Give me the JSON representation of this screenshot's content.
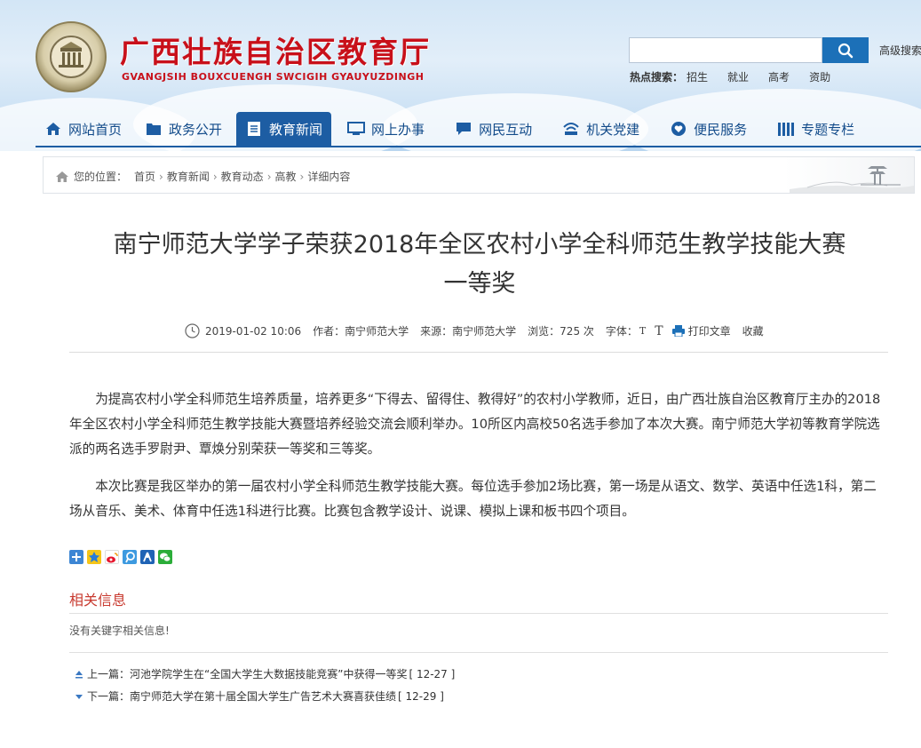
{
  "header": {
    "title": "广西壮族自治区教育厅",
    "subtitle": "GVANGJSIH BOUXCUENGH SWCIGIH GYAUYUZDINGH",
    "search": {
      "placeholder": "",
      "advanced_label": "高级搜索"
    },
    "hot": {
      "label": "热点搜索：",
      "keywords": [
        "招生",
        "就业",
        "高考",
        "资助"
      ]
    }
  },
  "nav": [
    {
      "label": "网站首页",
      "icon": "home-icon",
      "active": false
    },
    {
      "label": "政务公开",
      "icon": "folder-icon",
      "active": false
    },
    {
      "label": "教育新闻",
      "icon": "document-icon",
      "active": true
    },
    {
      "label": "网上办事",
      "icon": "monitor-icon",
      "active": false
    },
    {
      "label": "网民互动",
      "icon": "chat-icon",
      "active": false
    },
    {
      "label": "机关党建",
      "icon": "building-icon",
      "active": false
    },
    {
      "label": "便民服务",
      "icon": "heart-icon",
      "active": false
    },
    {
      "label": "专题专栏",
      "icon": "columns-icon",
      "active": false
    }
  ],
  "breadcrumb": {
    "prefix": "您的位置：",
    "items": [
      "首页",
      "教育新闻",
      "教育动态",
      "高教",
      "详细内容"
    ]
  },
  "article": {
    "title_line1": "南宁师范大学学子荣获2018年全区农村小学全科师范生教学技能大赛",
    "title_line2": "一等奖",
    "date": "2019-01-02 10:06",
    "author": "作者：南宁师范大学",
    "source": "来源：南宁师范大学",
    "views": "浏览：725 次",
    "font_label": "字体：",
    "font_small": "T",
    "font_large": "T",
    "print": "打印文章",
    "favorite": "收藏",
    "paragraphs": [
      "为提高农村小学全科师范生培养质量，培养更多“下得去、留得住、教得好”的农村小学教师，近日，由广西壮族自治区教育厅主办的2018年全区农村小学全科师范生教学技能大赛暨培养经验交流会顺利举办。10所区内高校50名选手参加了本次大赛。南宁师范大学初等教育学院选派的两名选手罗尉尹、覃焕分别荣获一等奖和三等奖。",
      "本次比赛是我区举办的第一届农村小学全科师范生教学技能大赛。每位选手参加2场比赛，第一场是从语文、数学、英语中任选1科，第二场从音乐、美术、体育中任选1科进行比赛。比赛包含教学设计、说课、模拟上课和板书四个项目。"
    ]
  },
  "share_icons": [
    "share-more-icon",
    "qzone-icon",
    "weibo-icon",
    "tencent-weibo-icon",
    "renren-icon",
    "wechat-icon"
  ],
  "related": {
    "title": "相关信息",
    "empty": "没有关键字相关信息!"
  },
  "prev": {
    "label": "上一篇：",
    "title": "河池学院学生在“全国大学生大数据技能竞赛”中获得一等奖",
    "date": "[ 12-27 ]"
  },
  "next": {
    "label": "下一篇：",
    "title": "南宁师范大学在第十届全国大学生广告艺术大赛喜获佳绩",
    "date": "[ 12-29 ]"
  },
  "colors": {
    "brand_red": "#c8101a",
    "nav_blue": "#1d5da3",
    "search_blue": "#1c70b8"
  }
}
